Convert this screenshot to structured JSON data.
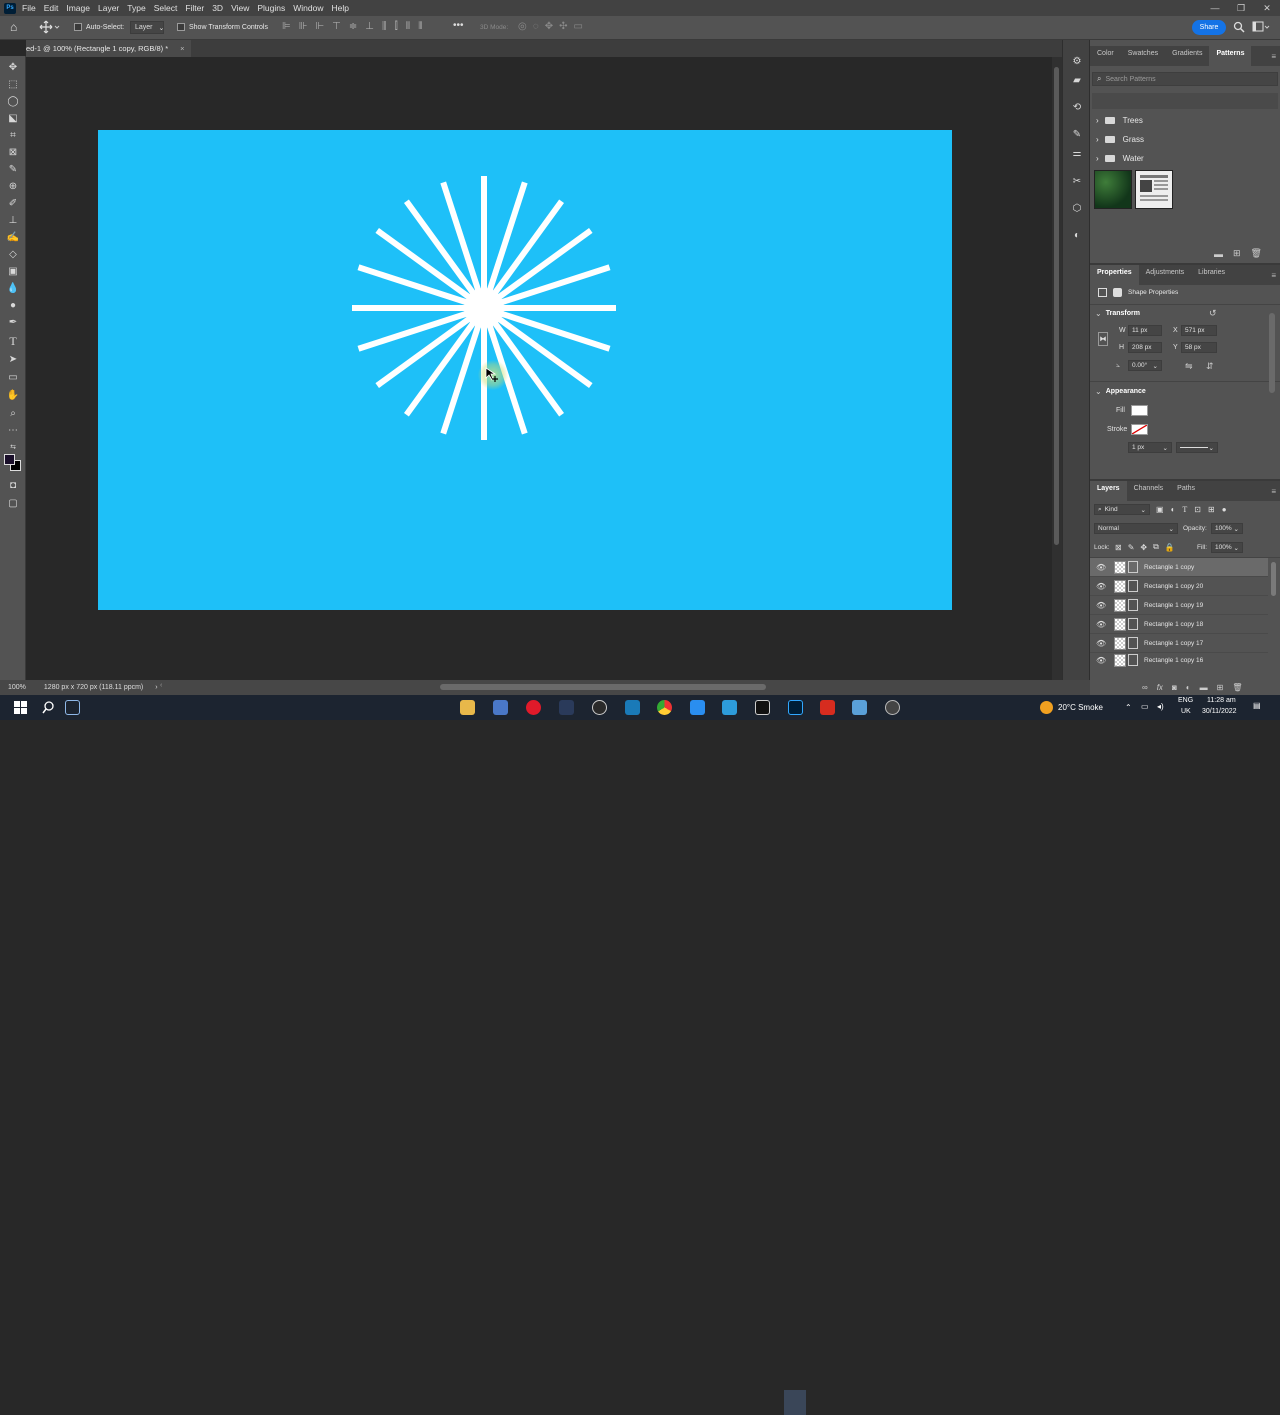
{
  "menubar": {
    "logo": "Ps",
    "items": [
      "File",
      "Edit",
      "Image",
      "Layer",
      "Type",
      "Select",
      "Filter",
      "3D",
      "View",
      "Plugins",
      "Window",
      "Help"
    ],
    "window_controls": [
      "—",
      "❐",
      "✕"
    ]
  },
  "options": {
    "auto_select_label": "Auto-Select:",
    "auto_select_target": "Layer",
    "show_transform_label": "Show Transform Controls",
    "three_d_mode_label": "3D Mode:",
    "share_label": "Share"
  },
  "document_tab": {
    "title": "ed-1 @ 100% (Rectangle 1 copy, RGB/8) *",
    "close": "×"
  },
  "canvas": {
    "background_color": "#1ec0f8",
    "burst_color": "#ffffff",
    "ray_count": 20
  },
  "status": {
    "zoom": "100%",
    "doc_info": "1280 px x 720 px (118.11 ppcm)",
    "arrow": "›"
  },
  "patterns_panel": {
    "tabs": [
      "Color",
      "Swatches",
      "Gradients",
      "Patterns"
    ],
    "active_tab": "Patterns",
    "search_placeholder": "Search Patterns",
    "folders": [
      "Trees",
      "Grass",
      "Water"
    ]
  },
  "properties_panel": {
    "tabs": [
      "Properties",
      "Adjustments",
      "Libraries"
    ],
    "active_tab": "Properties",
    "subtitle": "Shape Properties",
    "transform_header": "Transform",
    "w_label": "W",
    "w_value": "11 px",
    "x_label": "X",
    "x_value": "571 px",
    "h_label": "H",
    "h_value": "208 px",
    "y_label": "Y",
    "y_value": "58 px",
    "angle_value": "0.00°",
    "appearance_header": "Appearance",
    "fill_label": "Fill",
    "stroke_label": "Stroke",
    "stroke_width": "1 px"
  },
  "layers_panel": {
    "tabs": [
      "Layers",
      "Channels",
      "Paths"
    ],
    "active_tab": "Layers",
    "filter_kind": "Kind",
    "blend_mode": "Normal",
    "opacity_label": "Opacity:",
    "opacity_value": "100%",
    "lock_label": "Lock:",
    "fill_label": "Fill:",
    "fill_value": "100%",
    "layers": [
      {
        "name": "Rectangle 1 copy",
        "selected": true
      },
      {
        "name": "Rectangle 1 copy 20",
        "selected": false
      },
      {
        "name": "Rectangle 1 copy 19",
        "selected": false
      },
      {
        "name": "Rectangle 1 copy 18",
        "selected": false
      },
      {
        "name": "Rectangle 1 copy 17",
        "selected": false
      },
      {
        "name": "Rectangle 1 copy 16",
        "selected": false
      }
    ],
    "footer_fx": "fx"
  },
  "taskbar": {
    "weather": "20°C  Smoke",
    "lang_top": "ENG",
    "lang_bottom": "UK",
    "time": "11:28 am",
    "date": "30/11/2022"
  }
}
